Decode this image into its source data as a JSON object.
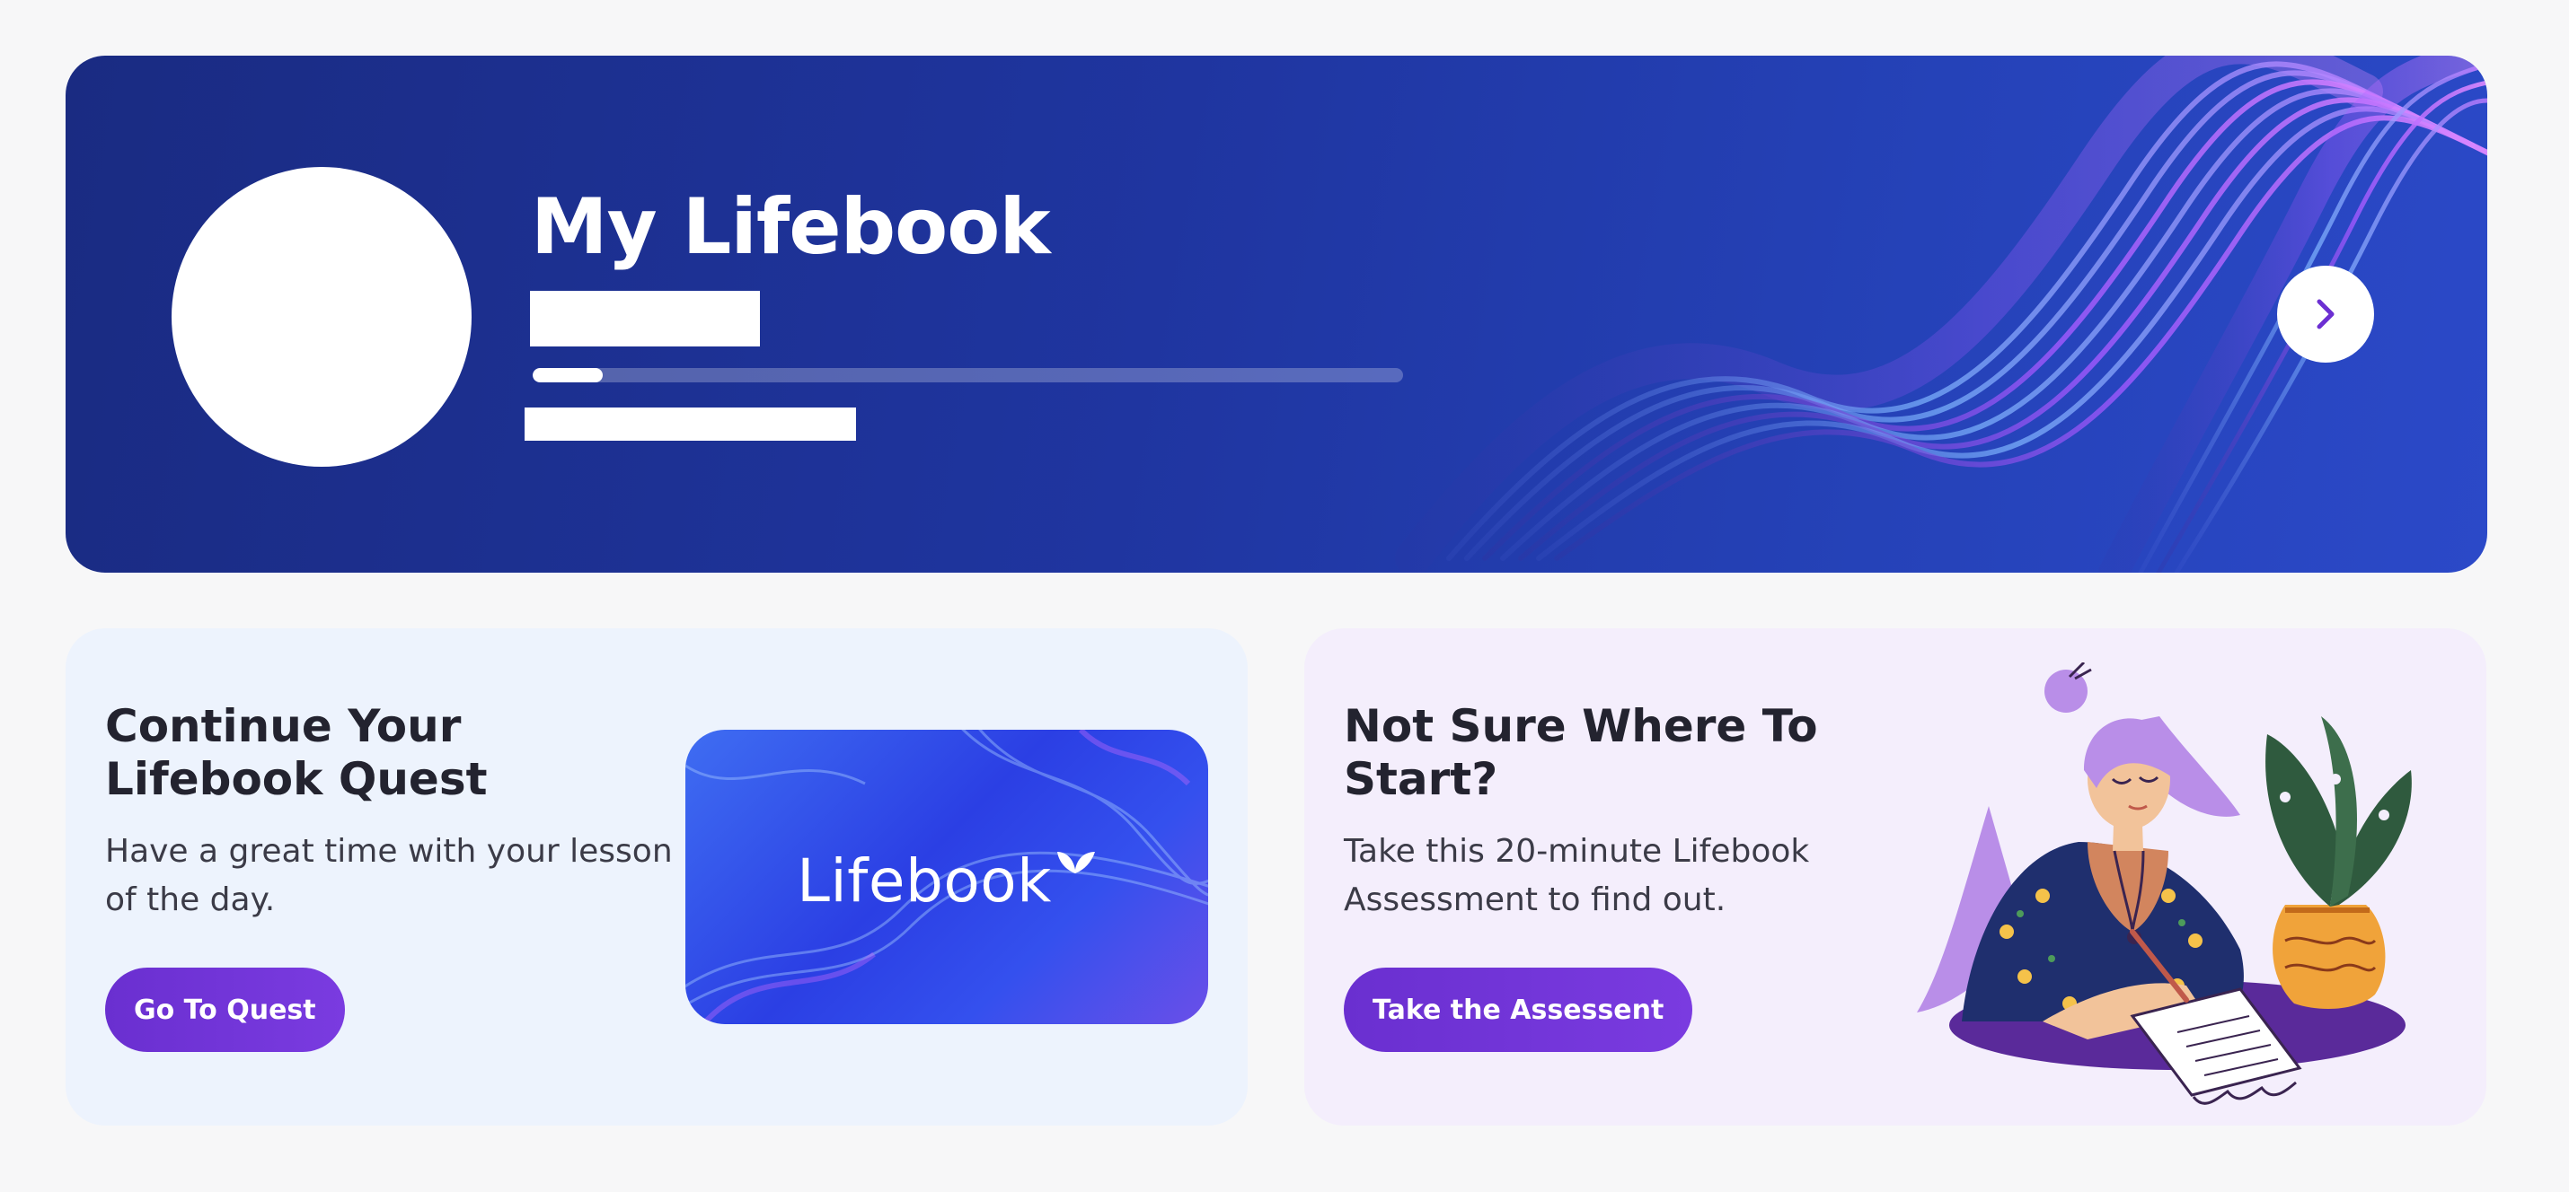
{
  "hero": {
    "title": "My Lifebook",
    "progress": 0.08,
    "next_icon": "chevron-right-icon"
  },
  "quest_card": {
    "title": "Continue Your Lifebook Quest",
    "description": "Have a great time with your lesson of the day.",
    "button_label": "Go To Quest",
    "thumbnail_brand": "Lifebook"
  },
  "assessment_card": {
    "title": "Not Sure Where To Start?",
    "description": "Take this 20-minute Lifebook Assessment to find out.",
    "button_label": "Take the Assessent"
  },
  "colors": {
    "accent": "#7036d8",
    "hero_bg": "#1f35a0",
    "quest_card_bg": "#edf3fd",
    "assessment_card_bg": "#f4eefc"
  }
}
